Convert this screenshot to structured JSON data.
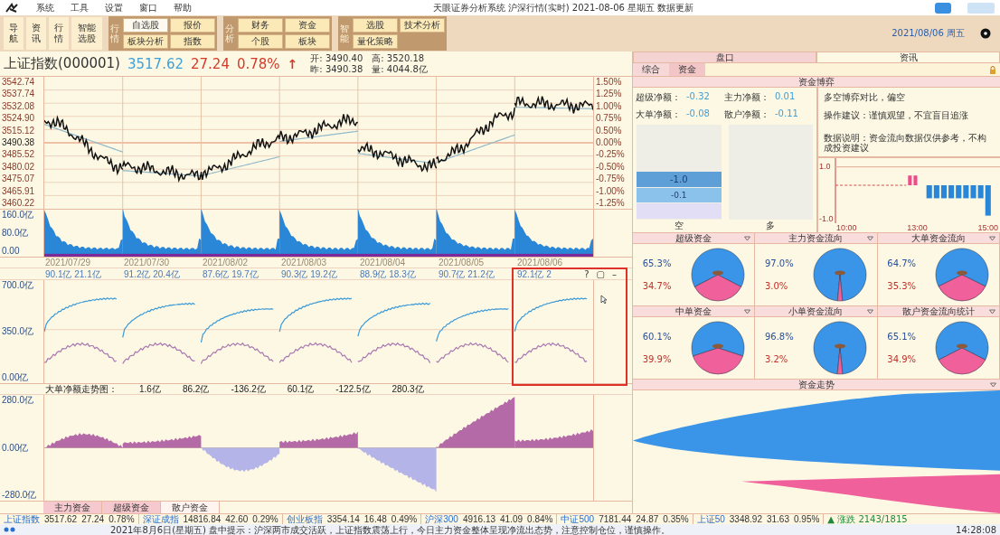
{
  "menu_bar": {
    "items": [
      "系统",
      "工具",
      "设置",
      "窗口",
      "帮助"
    ],
    "title": "天眼证券分析系统 沪深行情(实时) 2021-08-06 星期五 数据更新"
  },
  "toolbar": {
    "nav_buttons": [
      {
        "label": "导航",
        "kind": "narrow"
      },
      {
        "label": "资讯",
        "kind": "narrow"
      },
      {
        "label": "行情",
        "kind": "narrow"
      },
      {
        "label": "智能选股",
        "kind": "wide"
      }
    ],
    "groups": [
      {
        "label": "行情",
        "buttons": [
          {
            "label": "自选股",
            "selected": true
          },
          {
            "label": "报价",
            "selected": false
          },
          {
            "label": "板块分析",
            "selected": false
          },
          {
            "label": "指数",
            "selected": false
          }
        ]
      },
      {
        "label": "分析",
        "buttons": [
          {
            "label": "财务",
            "selected": false
          },
          {
            "label": "资金",
            "selected": false
          },
          {
            "label": "个股",
            "selected": false
          },
          {
            "label": "板块",
            "selected": false
          }
        ]
      },
      {
        "label": "智能",
        "buttons": [
          {
            "label": "选股",
            "selected": false
          },
          {
            "label": "技术分析",
            "selected": false
          },
          {
            "label": "量化策略",
            "selected": false
          }
        ]
      }
    ],
    "clock": "2021/08/06 周五"
  },
  "quote": {
    "name": "上证指数(000001)",
    "price": "3517.62",
    "change": "27.24",
    "percent": "0.78%",
    "arrow": "↑",
    "stats": [
      {
        "label": "开:",
        "value": "3490.40"
      },
      {
        "label": "高:",
        "value": "3520.18"
      },
      {
        "label": "昨:",
        "value": "3490.38"
      },
      {
        "label": "量:",
        "value": "4044.8亿"
      }
    ]
  },
  "price_chart": {
    "left_labels": [
      "3542.74",
      "3537.74",
      "3532.08",
      "3524.90",
      "3515.12",
      "3490.38",
      "3485.52",
      "3480.02",
      "3475.07",
      "3465.91",
      "3460.22"
    ],
    "right_labels": [
      "1.50%",
      "1.25%",
      "1.00%",
      "0.75%",
      "0.50%",
      "0.00%",
      "-0.25%",
      "-0.50%",
      "-0.75%",
      "-1.00%",
      "-1.25%"
    ],
    "volume_labels": [
      "160.0亿",
      "80.0亿",
      "0.00"
    ],
    "dates": [
      "2021/07/29",
      "2021/07/30",
      "2021/08/02",
      "2021/08/03",
      "2021/08/04",
      "2021/08/05",
      "2021/08/06"
    ]
  },
  "flow_chart": {
    "day_headers": [
      "90.1亿 21.1亿",
      "91.2亿 20.4亿",
      "87.6亿 19.7亿",
      "90.3亿 19.2亿",
      "88.9亿 18.3亿",
      "90.7亿 21.2亿",
      "92.1亿 2"
    ],
    "left_labels": [
      "700.0亿",
      "350.0亿",
      "0.00亿"
    ],
    "panel_buttons": [
      "?",
      "▢",
      "–"
    ]
  },
  "net_chart": {
    "title": "大单净额走势图：",
    "values": [
      "1.6亿",
      "86.2亿",
      "-136.2亿",
      "60.1亿",
      "-122.5亿",
      "280.3亿"
    ],
    "left_labels": [
      "280.0亿",
      "0.00亿",
      "-280.0亿"
    ]
  },
  "bottom_tabs": [
    {
      "label": "主力资金",
      "selected": false
    },
    {
      "label": "超级资金",
      "selected": false
    },
    {
      "label": "散户资金",
      "selected": true
    }
  ],
  "side": {
    "tabs": [
      {
        "label": "盘口",
        "selected": true
      },
      {
        "label": "资讯",
        "selected": false
      }
    ],
    "subtabs": [
      {
        "label": "综合",
        "selected": false
      },
      {
        "label": "资金",
        "selected": true
      }
    ],
    "funds_header": "资金博弈",
    "metrics": [
      {
        "label": "超级净额：",
        "value": "-0.32"
      },
      {
        "label": "主力净额：",
        "value": "0.01"
      },
      {
        "label": "大单净额：",
        "value": "-0.08"
      },
      {
        "label": "散户净额：",
        "value": "-0.11"
      }
    ],
    "gauge": {
      "reading": "-1.0",
      "sub_reading": "-0.1",
      "short_label": "空",
      "long_label": "多"
    },
    "advice": [
      "多空博弈对比，偏空",
      "操作建议：谨慎观望，不宜盲目追涨"
    ],
    "note": "数据说明：资金流向数据仅供参考，不构成投资建议",
    "mini_chart": {
      "y_labels": [
        "1.0",
        "-1.0"
      ],
      "x_labels": [
        "10:00",
        "13:00",
        "15:00"
      ]
    },
    "pies": [
      {
        "title": "超级资金",
        "top_label": "65.3%",
        "bottom_label": "34.7%",
        "chart_data": {
          "type": "pie",
          "values": [
            65.3,
            34.7
          ]
        }
      },
      {
        "title": "主力资金流向",
        "top_label": "97.0%",
        "bottom_label": "3.0%",
        "chart_data": {
          "type": "pie",
          "values": [
            97,
            3
          ]
        }
      },
      {
        "title": "大单资金流向",
        "top_label": "64.7%",
        "bottom_label": "35.3%",
        "chart_data": {
          "type": "pie",
          "values": [
            64.7,
            35.3
          ]
        }
      },
      {
        "title": "中单资金",
        "top_label": "60.1%",
        "bottom_label": "39.9%",
        "chart_data": {
          "type": "pie",
          "values": [
            60.1,
            39.9
          ]
        }
      },
      {
        "title": "小单资金流向",
        "top_label": "96.8%",
        "bottom_label": "3.2%",
        "chart_data": {
          "type": "pie",
          "values": [
            96.8,
            3.2
          ]
        }
      },
      {
        "title": "散户资金流向统计",
        "top_label": "65.1%",
        "bottom_label": "34.9%",
        "chart_data": {
          "type": "pie",
          "values": [
            65.1,
            34.9
          ]
        }
      }
    ],
    "trend_header": "资金走势"
  },
  "ticker": [
    {
      "name": "上证指数",
      "values": [
        "3517.62",
        "27.24",
        "0.78%"
      ]
    },
    {
      "name": "深证成指",
      "values": [
        "14816.84",
        "42.60",
        "0.29%"
      ]
    },
    {
      "name": "创业板指",
      "values": [
        "3354.14",
        "16.48",
        "0.49%"
      ]
    },
    {
      "name": "沪深300",
      "values": [
        "4916.13",
        "41.09",
        "0.84%"
      ]
    },
    {
      "name": "中证500",
      "values": [
        "7181.44",
        "24.87",
        "0.35%"
      ]
    },
    {
      "name": "上证50",
      "values": [
        "3348.92",
        "31.63",
        "0.95%"
      ]
    }
  ],
  "market_breadth": "▲ 涨跌 2143/1815",
  "status": {
    "text": "2021年8月6日(星期五) 盘中提示：沪深两市成交活跃，上证指数震荡上行，今日主力资金整体呈现净流出态势，注意控制仓位，谨慎操作。",
    "time": "14:28:08"
  }
}
